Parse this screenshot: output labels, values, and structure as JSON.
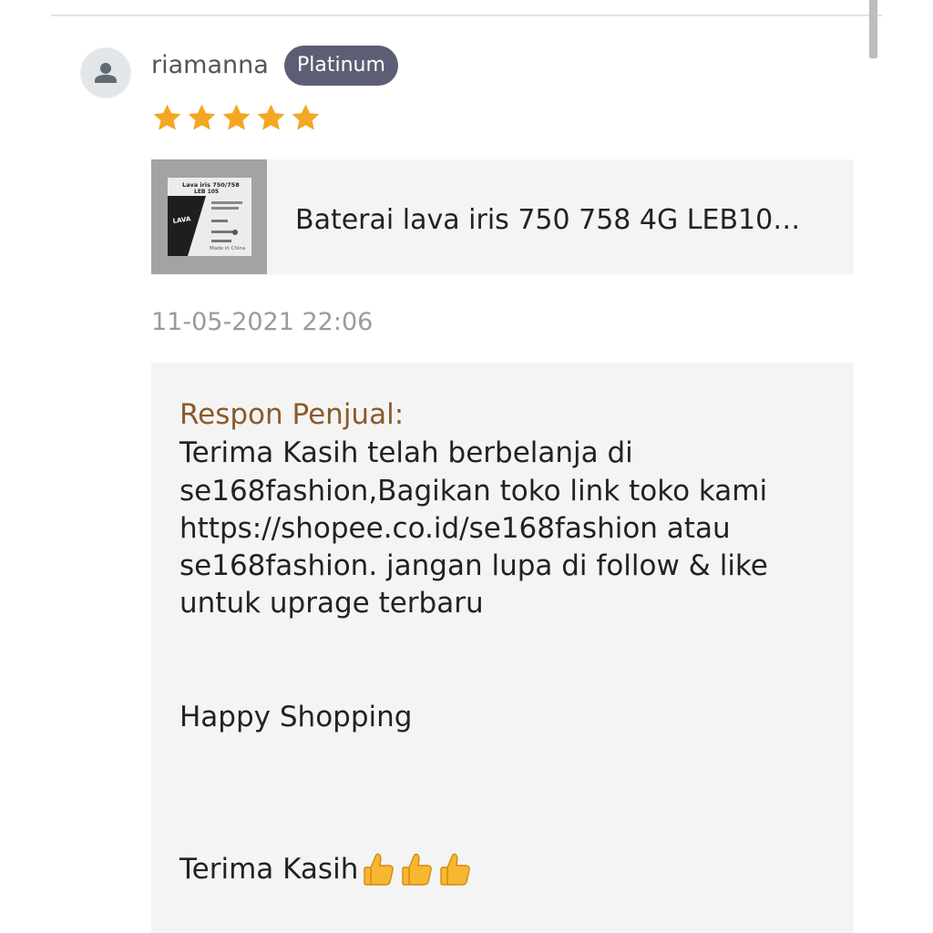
{
  "review": {
    "username": "riamanna",
    "badge": "Platinum",
    "rating": 5,
    "timestamp": "11-05-2021 22:06"
  },
  "product": {
    "name": "Baterai lava iris 750 758 4G LEB10…",
    "thumb_line1": "Lava iris 750/758",
    "thumb_line2": "LEB 105",
    "thumb_brand": "LAVA",
    "thumb_made": "Made in China"
  },
  "seller_response": {
    "title": "Respon Penjual:",
    "lines": [
      "Terima Kasih telah berbelanja di",
      "se168fashion,Bagikan toko link toko kami",
      "https://shopee.co.id/se168fashion atau",
      "se168fashion. jangan lupa di follow & like",
      "untuk uprage terbaru"
    ],
    "happy": "Happy Shopping",
    "thanks": "Terima Kasih"
  },
  "colors": {
    "star": "#f5a623",
    "badge_bg": "#5b5e75",
    "response_title": "#8b5a2b"
  },
  "icons": [
    "user-icon",
    "star-icon",
    "thumbs-up-icon"
  ]
}
